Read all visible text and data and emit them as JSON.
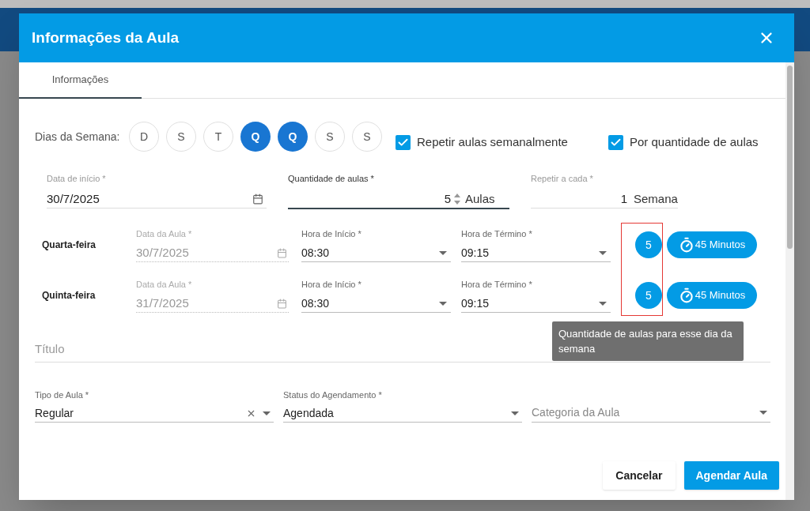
{
  "dialog": {
    "title": "Informações da Aula"
  },
  "tabs": [
    {
      "label": "Informações",
      "selected": true
    }
  ],
  "weekdays": {
    "label": "Dias da Semana:",
    "days": [
      {
        "letter": "D",
        "selected": false
      },
      {
        "letter": "S",
        "selected": false
      },
      {
        "letter": "T",
        "selected": false
      },
      {
        "letter": "Q",
        "selected": true
      },
      {
        "letter": "Q",
        "selected": true
      },
      {
        "letter": "S",
        "selected": false
      },
      {
        "letter": "S",
        "selected": false
      }
    ]
  },
  "options": [
    {
      "label": "Repetir aulas semanalmente",
      "checked": true
    },
    {
      "label": "Por quantidade de aulas",
      "checked": true
    }
  ],
  "fields": [
    {
      "kind": "date",
      "label": "Data de início *",
      "value": "30/7/2025"
    },
    {
      "kind": "number",
      "label": "Quantidade de aulas *",
      "value": "5",
      "suffix": "Aulas",
      "focused": true
    },
    {
      "kind": "plain",
      "label": "Repetir a cada *",
      "value": "1",
      "suffix": "Semana",
      "focused": false
    }
  ],
  "schedule": [
    {
      "day": "Quarta-feira",
      "date_label": "Data da Aula *",
      "date": "30/7/2025",
      "start_label": "Hora de Início *",
      "start": "08:30",
      "end_label": "Hora de Término *",
      "end": "09:15",
      "count": "5",
      "duration": "45 Minutos"
    },
    {
      "day": "Quinta-feira",
      "date_label": "Data da Aula *",
      "date": "31/7/2025",
      "start_label": "Hora de Início *",
      "start": "08:30",
      "end_label": "Hora de Término *",
      "end": "09:15",
      "count": "5",
      "duration": "45 Minutos"
    }
  ],
  "count_highlight": true,
  "tooltip": "Quantidade de aulas para esse dia da semana",
  "title_field": {
    "placeholder": "Título"
  },
  "selects": [
    {
      "label": "Tipo de Aula *",
      "value": "Regular",
      "clearable": true
    },
    {
      "label": "Status do Agendamento *",
      "value": "Agendada",
      "clearable": false
    },
    {
      "placeholder": "Categoria da Aula",
      "clearable": false
    }
  ],
  "buttons": [
    {
      "kind": "secondary",
      "label": "Cancelar"
    },
    {
      "kind": "primary",
      "label": "Agendar Aula"
    }
  ]
}
